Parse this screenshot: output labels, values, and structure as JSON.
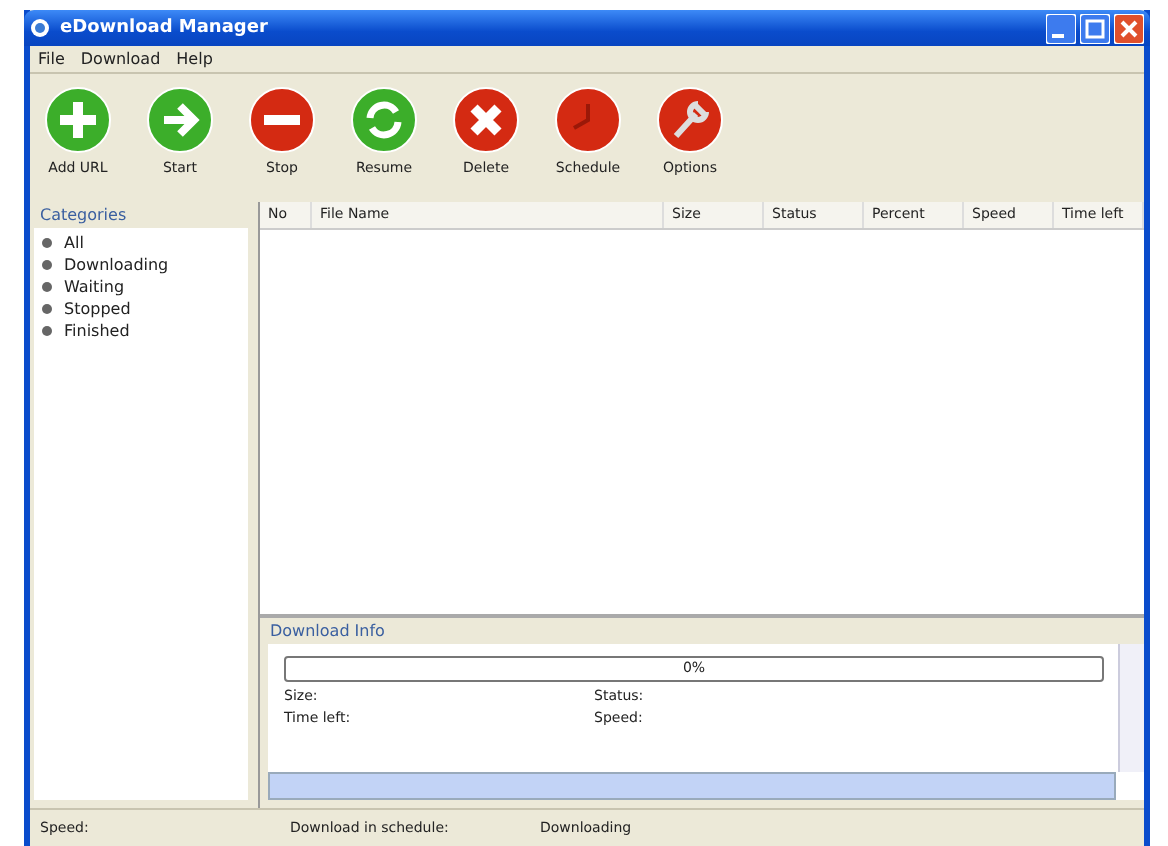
{
  "window": {
    "title": "eDownload Manager"
  },
  "menu": [
    "File",
    "Download",
    "Help"
  ],
  "toolbar": [
    {
      "kind": "add",
      "label": "Add URL"
    },
    {
      "kind": "start",
      "label": "Start"
    },
    {
      "kind": "stop",
      "label": "Stop"
    },
    {
      "kind": "resume",
      "label": "Resume"
    },
    {
      "kind": "delete",
      "label": "Delete"
    },
    {
      "kind": "schedule",
      "label": "Schedule"
    },
    {
      "kind": "options",
      "label": "Options"
    }
  ],
  "categories": {
    "title": "Categories",
    "items": [
      "All",
      "Downloading",
      "Waiting",
      "Stopped",
      "Finished"
    ]
  },
  "table": {
    "columns": [
      "No",
      "File Name",
      "Size",
      "Status",
      "Percent",
      "Speed",
      "Time left"
    ]
  },
  "download_info": {
    "title": "Download Info",
    "progress": {
      "level": 0,
      "text": "0%"
    },
    "fields": [
      [
        "Size:",
        "Status:"
      ],
      [
        "Time left:",
        "Speed:"
      ]
    ]
  },
  "status_bar": [
    "Speed:",
    "Download in schedule:",
    "Downloading"
  ]
}
